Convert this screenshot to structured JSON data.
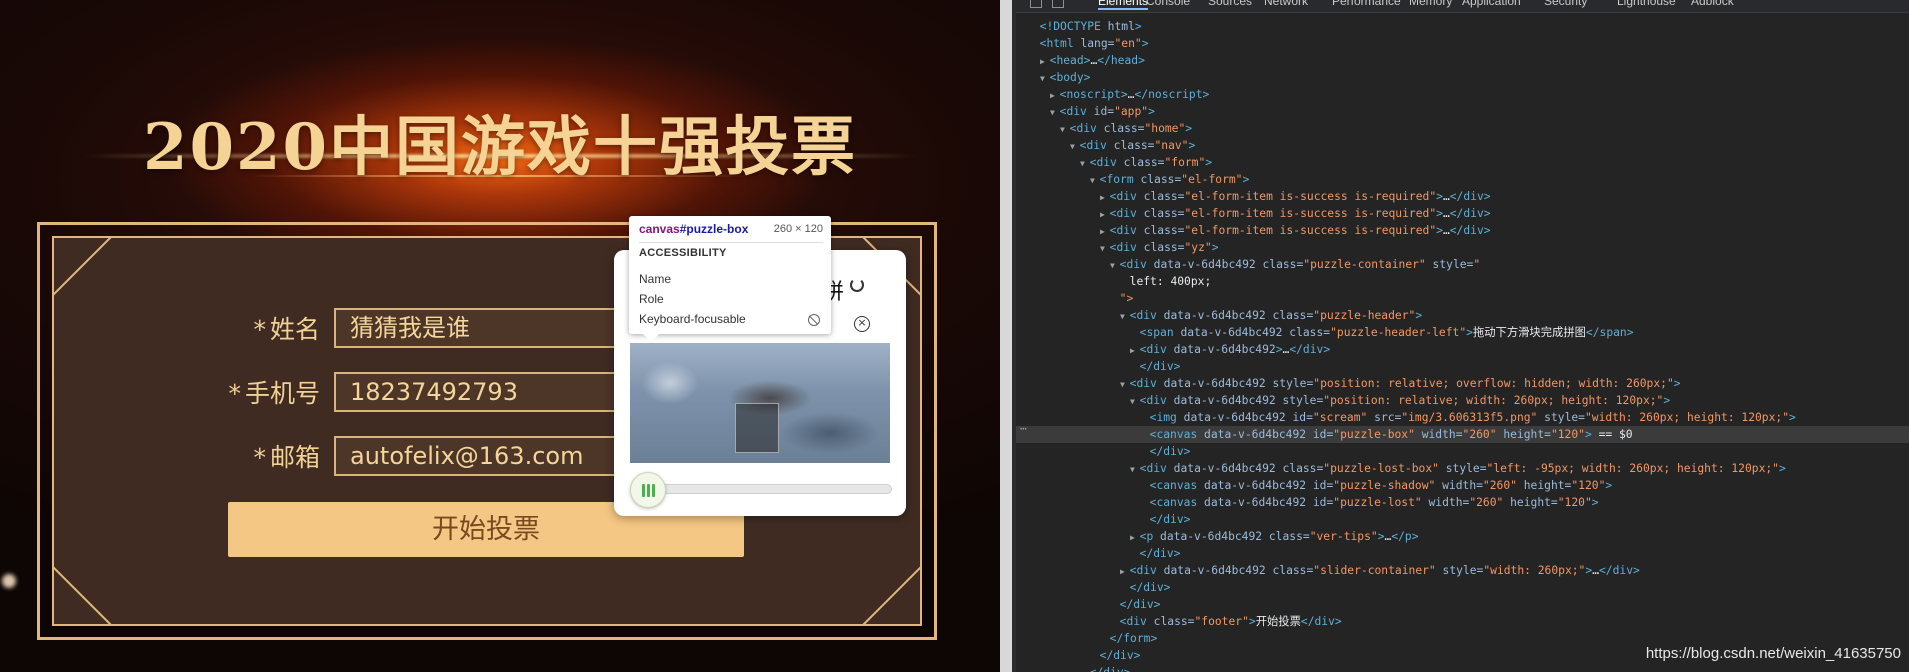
{
  "page": {
    "title": "2020中国游戏十强投票",
    "form": {
      "required_mark": "*",
      "name_label": "姓名",
      "name_value": "猜猜我是谁",
      "phone_label": "手机号",
      "phone_value": "18237492793",
      "email_label": "邮箱",
      "email_value": "autofelix@163.com",
      "submit_label": "开始投票"
    },
    "puzzle": {
      "header_visible_text": "拼",
      "slider_progress": 0.0
    }
  },
  "tooltip": {
    "tag": "canvas",
    "id": "#puzzle-box",
    "size": "260 × 120",
    "section": "ACCESSIBILITY",
    "rows": [
      "Name",
      "Role",
      "Keyboard-focusable"
    ]
  },
  "devtools": {
    "tabs": [
      "Elements",
      "Console",
      "Sources",
      "Network",
      "Performance",
      "Memory",
      "Application",
      "Security",
      "Lighthouse",
      "Adblock"
    ],
    "active_tab": "Elements",
    "selected_line_index": 24,
    "lines": [
      {
        "indent": 0,
        "arrow": "",
        "html": "<!DOCTYPE html>"
      },
      {
        "indent": 0,
        "arrow": "",
        "html": "<html lang=\"en\">"
      },
      {
        "indent": 1,
        "arrow": "▶",
        "html": "<head>…</head>"
      },
      {
        "indent": 1,
        "arrow": "▼",
        "html": "<body>"
      },
      {
        "indent": 2,
        "arrow": "▶",
        "html": "<noscript>…</noscript>"
      },
      {
        "indent": 2,
        "arrow": "▼",
        "html": "<div id=\"app\">"
      },
      {
        "indent": 3,
        "arrow": "▼",
        "html": "<div class=\"home\">"
      },
      {
        "indent": 4,
        "arrow": "▼",
        "html": "<div class=\"nav\">"
      },
      {
        "indent": 5,
        "arrow": "▼",
        "html": "<div class=\"form\">"
      },
      {
        "indent": 6,
        "arrow": "▼",
        "html": "<form class=\"el-form\">"
      },
      {
        "indent": 7,
        "arrow": "▶",
        "html": "<div class=\"el-form-item is-success is-required\">…</div>"
      },
      {
        "indent": 7,
        "arrow": "▶",
        "html": "<div class=\"el-form-item is-success is-required\">…</div>"
      },
      {
        "indent": 7,
        "arrow": "▶",
        "html": "<div class=\"el-form-item is-success is-required\">…</div>"
      },
      {
        "indent": 7,
        "arrow": "▼",
        "html": "<div class=\"yz\">"
      },
      {
        "indent": 8,
        "arrow": "▼",
        "html": "<div data-v-6d4bc492 class=\"puzzle-container\" style=\""
      },
      {
        "indent": 9,
        "arrow": "",
        "html": "left: 400px;"
      },
      {
        "indent": 8,
        "arrow": "",
        "html": "\">"
      },
      {
        "indent": 9,
        "arrow": "▼",
        "html": "<div data-v-6d4bc492 class=\"puzzle-header\">"
      },
      {
        "indent": 10,
        "arrow": "",
        "html": "<span data-v-6d4bc492 class=\"puzzle-header-left\">拖动下方滑块完成拼图</span>"
      },
      {
        "indent": 10,
        "arrow": "▶",
        "html": "<div data-v-6d4bc492>…</div>"
      },
      {
        "indent": 10,
        "arrow": "",
        "html": "</div>"
      },
      {
        "indent": 9,
        "arrow": "▼",
        "html": "<div data-v-6d4bc492 style=\"position: relative; overflow: hidden; width: 260px;\">"
      },
      {
        "indent": 10,
        "arrow": "▼",
        "html": "<div data-v-6d4bc492 style=\"position: relative; width: 260px; height: 120px;\">"
      },
      {
        "indent": 11,
        "arrow": "",
        "html": "<img data-v-6d4bc492 id=\"scream\" src=\"img/3.606313f5.png\" style=\"width: 260px; height: 120px;\">"
      },
      {
        "indent": 11,
        "arrow": "",
        "html": "<canvas data-v-6d4bc492 id=\"puzzle-box\" width=\"260\" height=\"120\"> == $0"
      },
      {
        "indent": 11,
        "arrow": "",
        "html": "</div>"
      },
      {
        "indent": 10,
        "arrow": "▼",
        "html": "<div data-v-6d4bc492 class=\"puzzle-lost-box\" style=\"left: -95px; width: 260px; height: 120px;\">"
      },
      {
        "indent": 11,
        "arrow": "",
        "html": "<canvas data-v-6d4bc492 id=\"puzzle-shadow\" width=\"260\" height=\"120\">"
      },
      {
        "indent": 11,
        "arrow": "",
        "html": "<canvas data-v-6d4bc492 id=\"puzzle-lost\" width=\"260\" height=\"120\">"
      },
      {
        "indent": 11,
        "arrow": "",
        "html": "</div>"
      },
      {
        "indent": 10,
        "arrow": "▶",
        "html": "<p data-v-6d4bc492 class=\"ver-tips\">…</p>"
      },
      {
        "indent": 10,
        "arrow": "",
        "html": "</div>"
      },
      {
        "indent": 9,
        "arrow": "▶",
        "html": "<div data-v-6d4bc492 class=\"slider-container\" style=\"width: 260px;\">…</div>"
      },
      {
        "indent": 9,
        "arrow": "",
        "html": "</div>"
      },
      {
        "indent": 8,
        "arrow": "",
        "html": "</div>"
      },
      {
        "indent": 8,
        "arrow": "",
        "html": "<div class=\"footer\">开始投票</div>"
      },
      {
        "indent": 7,
        "arrow": "",
        "html": "</form>"
      },
      {
        "indent": 6,
        "arrow": "",
        "html": "</div>"
      },
      {
        "indent": 5,
        "arrow": "",
        "html": "</div>"
      }
    ]
  },
  "watermark": "https://blog.csdn.net/weixin_41635750"
}
